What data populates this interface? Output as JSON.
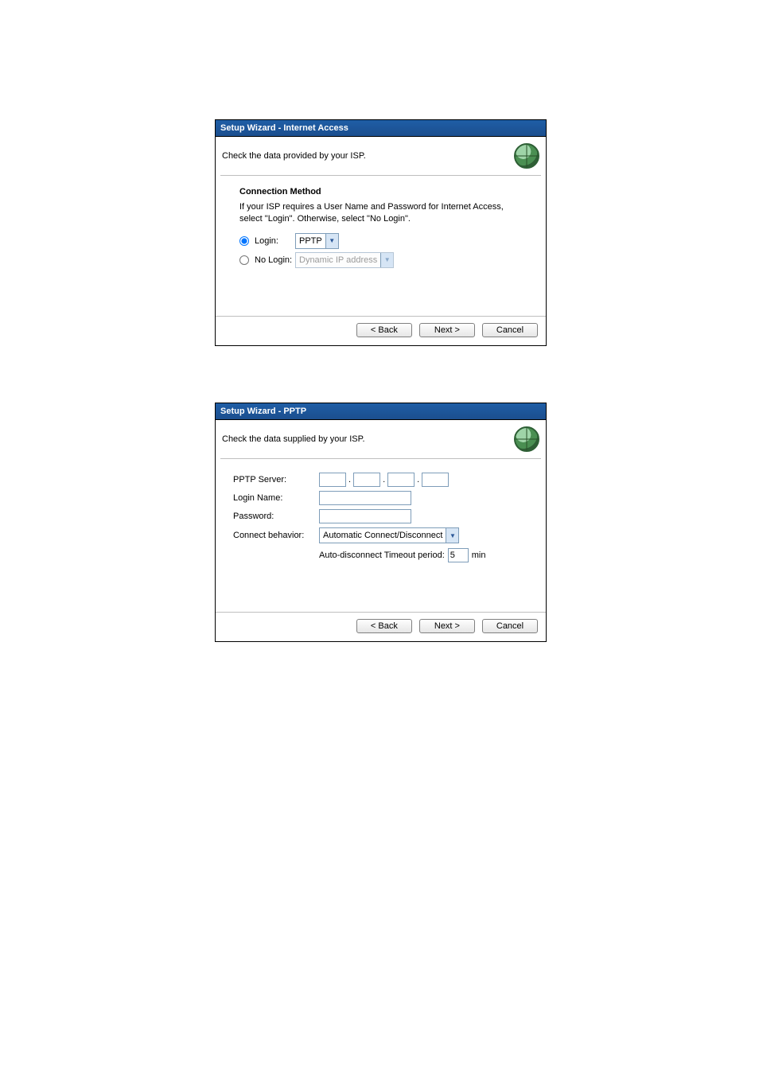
{
  "dialog1": {
    "title": "Setup Wizard - Internet Access",
    "subtitle": "Check the data provided by your ISP.",
    "section_heading": "Connection Method",
    "description": "If your ISP requires a User Name and Password for Internet Access, select \"Login\". Otherwise, select \"No Login\".",
    "login_label": "Login:",
    "nologin_label": "No Login:",
    "login_select": "PPTP",
    "nologin_select": "Dynamic IP address",
    "buttons": {
      "back": "< Back",
      "next": "Next >",
      "cancel": "Cancel"
    }
  },
  "dialog2": {
    "title": "Setup Wizard - PPTP",
    "subtitle": "Check the data supplied by your ISP.",
    "labels": {
      "pptp_server": "PPTP Server:",
      "login_name": "Login Name:",
      "password": "Password:",
      "connect_behavior": "Connect behavior:"
    },
    "connect_behavior_value": "Automatic Connect/Disconnect",
    "timeout_label_prefix": "Auto-disconnect Timeout period:",
    "timeout_value": "5",
    "timeout_unit": "min",
    "buttons": {
      "back": "< Back",
      "next": "Next >",
      "cancel": "Cancel"
    }
  }
}
